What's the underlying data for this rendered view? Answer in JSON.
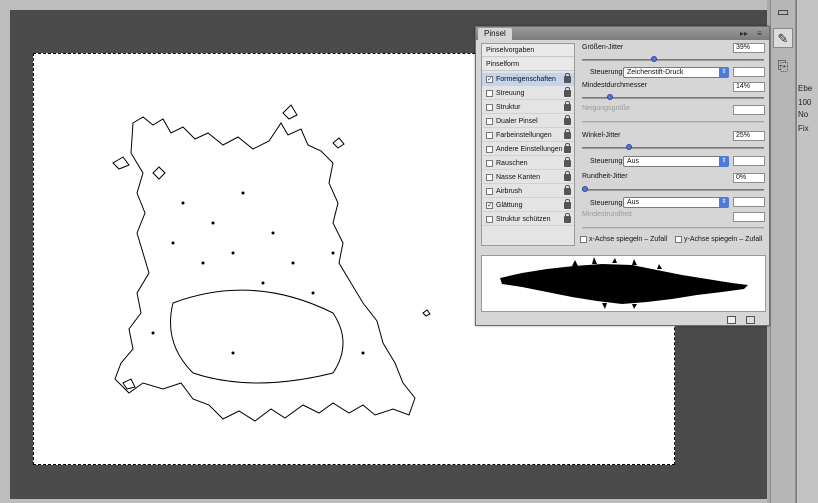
{
  "panel": {
    "tab": "Pinsel",
    "controls": [
      "▸▸",
      "≡"
    ],
    "list_items": [
      {
        "label": "Pinselvorgaben",
        "kind": "header"
      },
      {
        "label": "Pinselform",
        "kind": "header"
      },
      {
        "label": "Formeigenschaften",
        "checked": true,
        "selected": true
      },
      {
        "label": "Streuung",
        "checked": false
      },
      {
        "label": "Struktur",
        "checked": false
      },
      {
        "label": "Dualer Pinsel",
        "checked": false
      },
      {
        "label": "Farbeinstellungen",
        "checked": false
      },
      {
        "label": "Andere Einstellungen",
        "checked": false
      },
      {
        "label": "Rauschen",
        "checked": false
      },
      {
        "label": "Nasse Kanten",
        "checked": false
      },
      {
        "label": "Airbrush",
        "checked": false
      },
      {
        "label": "Glättung",
        "checked": true
      },
      {
        "label": "Struktur schützen",
        "checked": false
      }
    ],
    "settings": {
      "size_jitter_label": "Größen-Jitter",
      "size_jitter_value": "39%",
      "size_jitter_level": 39,
      "control_label": "Steuerung:",
      "control1_value": "Zeichenstift-Druck",
      "min_diameter_label": "Mindestdurchmesser",
      "min_diameter_value": "14%",
      "min_diameter_level": 14,
      "tilt_scale_label": "Neigungsgröße",
      "angle_jitter_label": "Winkel-Jitter",
      "angle_jitter_value": "25%",
      "angle_jitter_level": 25,
      "control2_value": "Aus",
      "roundness_jitter_label": "Rundheit-Jitter",
      "roundness_jitter_value": "0%",
      "roundness_jitter_level": 0,
      "control3_value": "Aus",
      "min_roundness_label": "Mindestrundheit",
      "flip_x_label": "x-Achse spiegeln – Zufall",
      "flip_y_label": "y-Achse spiegeln – Zufall"
    }
  },
  "side": {
    "labels": [
      "100",
      "Ebe",
      "No",
      "Fix"
    ]
  },
  "colors": {
    "accent": "#4f7bd8",
    "selection": "#c4d4ec"
  }
}
